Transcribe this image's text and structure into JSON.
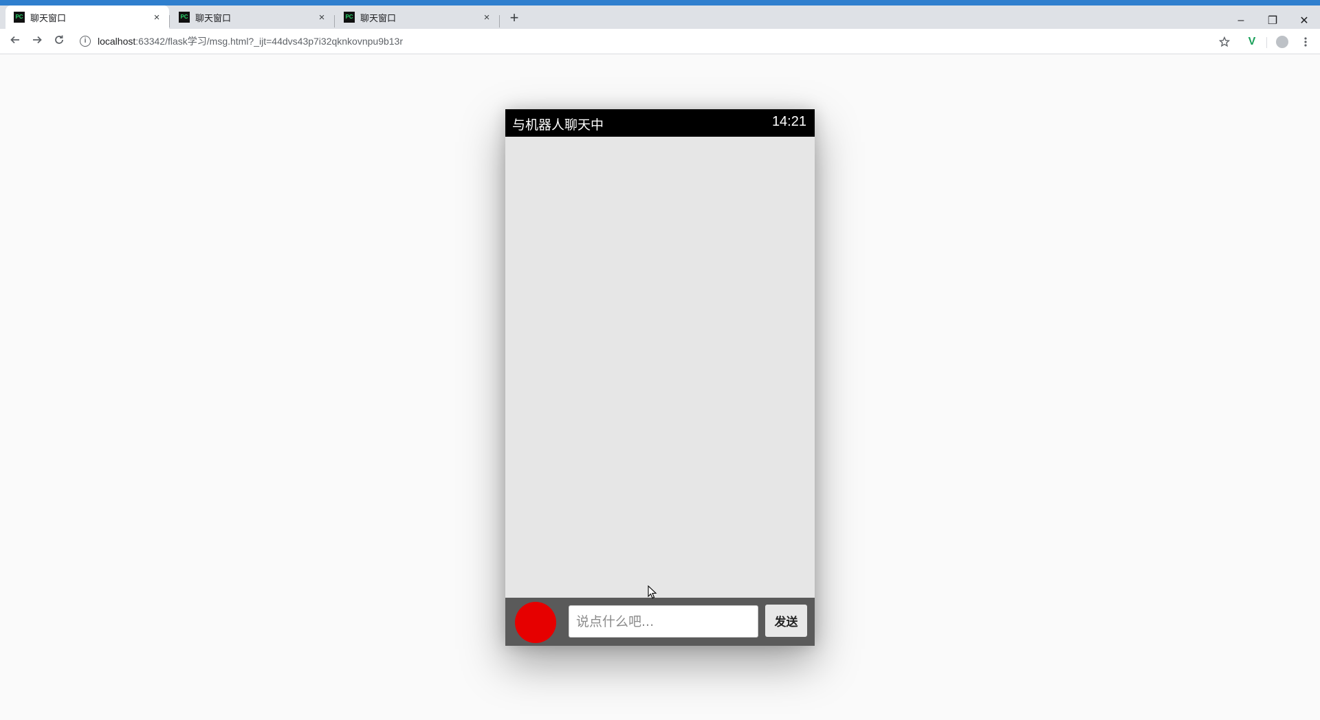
{
  "browser": {
    "tabs": [
      {
        "title": "聊天窗口",
        "favicon": "PC",
        "active": true
      },
      {
        "title": "聊天窗口",
        "favicon": "PC",
        "active": false
      },
      {
        "title": "聊天窗口",
        "favicon": "PC",
        "active": false
      }
    ],
    "tab_close": "×",
    "new_tab": "+",
    "window_controls": {
      "minimize": "–",
      "restore": "❐",
      "close": "✕"
    },
    "address": {
      "host": "localhost",
      "path": ":63342/flask学习/msg.html?_ijt=44dvs43p7i32qknkovnpu9b13r"
    },
    "icons": {
      "back": "back-arrow-icon",
      "forward": "forward-arrow-icon",
      "reload": "reload-icon",
      "site_info": "info-icon",
      "bookmark": "star-icon",
      "extension": "v-extension-icon",
      "profile": "avatar-icon",
      "menu": "kebab-menu-icon"
    }
  },
  "chat": {
    "title": "与机器人聊天中",
    "time": "14:21",
    "input_placeholder": "说点什么吧...",
    "send_label": "发送",
    "record_button_color": "#e60000",
    "messages": []
  }
}
